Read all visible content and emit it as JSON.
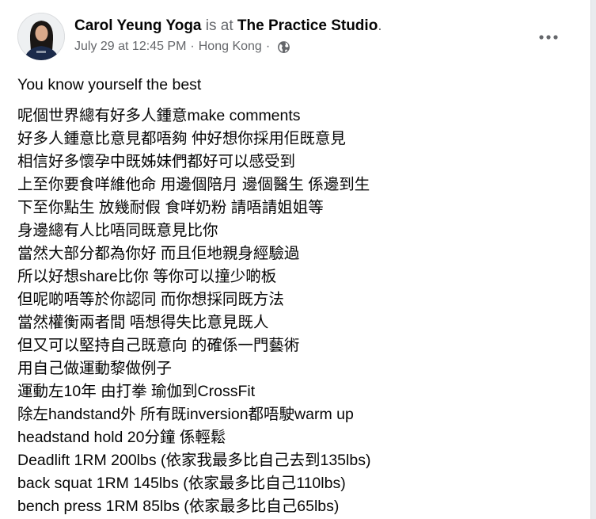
{
  "post": {
    "author": "Carol Yeung Yoga",
    "is_at": "is at",
    "place": "The Practice Studio",
    "place_suffix": ".",
    "timestamp": "July 29 at 12:45 PM",
    "separator": "·",
    "location": "Hong Kong",
    "privacy_icon": "globe-icon",
    "more_icon": "more-options-icon",
    "title_line": "You know yourself the best",
    "lines": [
      "呢個世界總有好多人鍾意make comments",
      "好多人鍾意比意見都唔夠 仲好想你採用佢既意見",
      "相信好多懷孕中既姊妹們都好可以感受到",
      "上至你要食咩維他命 用邊個陪月 邊個醫生 係邊到生",
      "下至你點生 放幾耐假 食咩奶粉 請唔請姐姐等",
      "身邊總有人比唔同既意見比你",
      "當然大部分都為你好 而且佢地親身經驗過",
      "所以好想share比你 等你可以撞少啲板",
      "但呢啲唔等於你認同 而你想採同既方法",
      "當然權衡兩者間 唔想得失比意見既人",
      "但又可以堅持自己既意向 的確係一門藝術",
      "用自己做運動黎做例子",
      "運動左10年 由打拳 瑜伽到CrossFit",
      "除左handstand外 所有既inversion都唔駛warm up",
      "headstand hold 20分鐘 係輕鬆",
      "Deadlift 1RM 200lbs (依家我最多比自己去到135lbs)",
      "back squat 1RM 145lbs (依家最多比自己110lbs)",
      "bench press 1RM 85lbs (依家最多比自己65lbs)"
    ]
  },
  "colors": {
    "text_primary": "#050505",
    "text_secondary": "#65676b",
    "card_bg": "#ffffff",
    "page_bg": "#e9ebee"
  }
}
